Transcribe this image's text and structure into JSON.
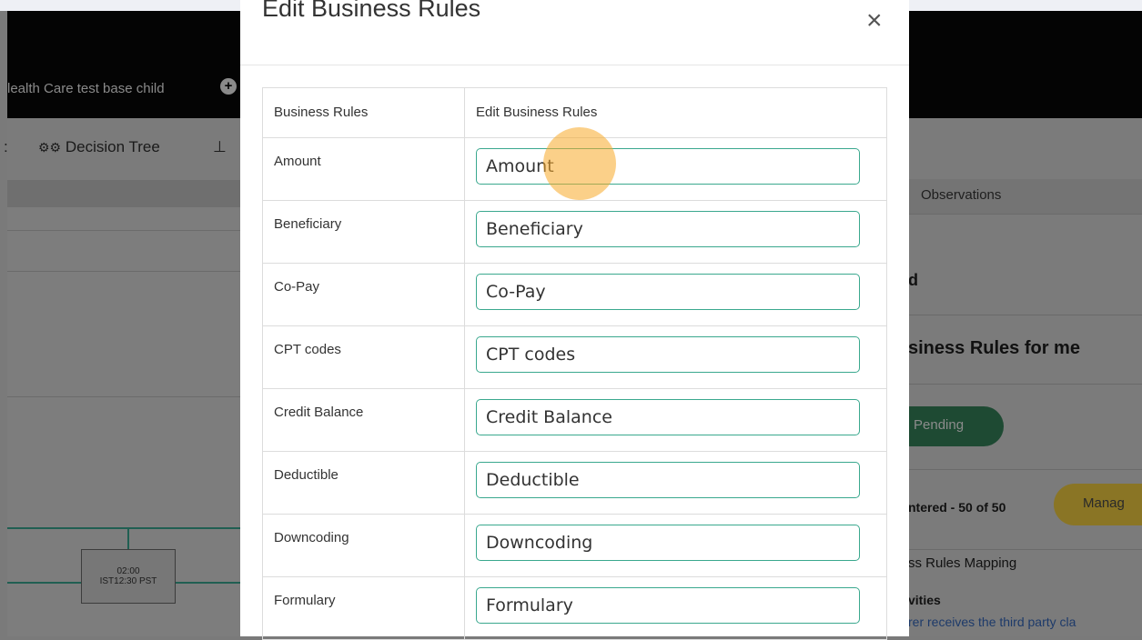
{
  "background": {
    "project_name": "lealth Care test base child",
    "toolbar": {
      "decision_tree_label": "Decision Tree"
    },
    "node": {
      "line1": "02:00",
      "line2": "IST12:30 PST"
    },
    "right_panel": {
      "tab_label": "Observations",
      "text_d": "d",
      "heading": "siness Rules for me",
      "pending_label": "Pending",
      "entered_label": "ntered - 50 of 50",
      "manage_label": "Manag",
      "mapping_label": "ss Rules Mapping",
      "activities_label": "vities",
      "activity_text": "rer receives the third party cla"
    }
  },
  "modal": {
    "title": "Edit Business Rules",
    "close_symbol": "×",
    "table": {
      "headers": [
        "Business Rules",
        "Edit Business Rules"
      ],
      "rows": [
        {
          "label": "Amount",
          "value": "Amount"
        },
        {
          "label": "Beneficiary",
          "value": "Beneficiary"
        },
        {
          "label": "Co-Pay",
          "value": "Co-Pay"
        },
        {
          "label": "CPT codes",
          "value": "CPT codes"
        },
        {
          "label": "Credit Balance",
          "value": "Credit Balance"
        },
        {
          "label": "Deductible",
          "value": "Deductible"
        },
        {
          "label": "Downcoding",
          "value": "Downcoding"
        },
        {
          "label": "Formulary",
          "value": "Formulary"
        }
      ]
    }
  },
  "colors": {
    "accent": "#3aa88e",
    "overlay": "#7a7a7a",
    "click_highlight": "#f7aa28"
  }
}
